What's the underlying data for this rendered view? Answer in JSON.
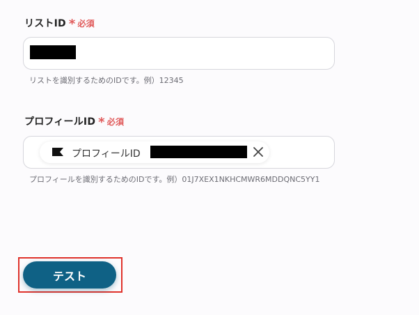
{
  "list_id": {
    "label": "リストID",
    "required_mark": "*",
    "required_text": "必須",
    "hint": "リストを識別するためのIDです。例）12345"
  },
  "profile_id": {
    "label": "プロフィールID",
    "required_mark": "*",
    "required_text": "必須",
    "chip_label": "プロフィールID",
    "chip_icon": "flag-icon",
    "hint": "プロフィールを識別するためのIDです。例）01J7XEX1NKHCMWR6MDDQNC5YY1"
  },
  "actions": {
    "test_label": "テスト"
  },
  "colors": {
    "required": "#e05a5a",
    "button_bg": "#0f6185",
    "highlight_outline": "#e0322b"
  }
}
